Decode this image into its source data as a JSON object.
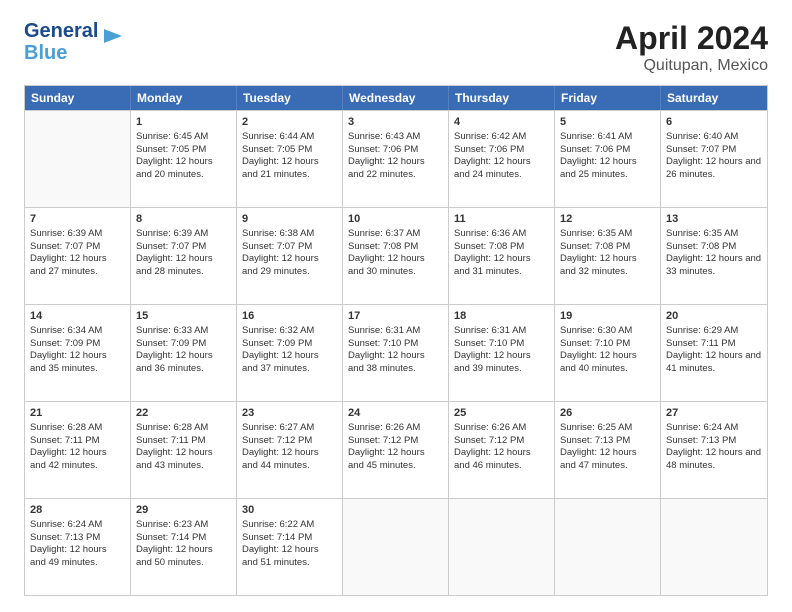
{
  "logo": {
    "line1": "General",
    "line2": "Blue"
  },
  "title": "April 2024",
  "subtitle": "Quitupan, Mexico",
  "weekdays": [
    "Sunday",
    "Monday",
    "Tuesday",
    "Wednesday",
    "Thursday",
    "Friday",
    "Saturday"
  ],
  "weeks": [
    [
      {
        "day": "",
        "info": ""
      },
      {
        "day": "1",
        "sunrise": "6:45 AM",
        "sunset": "7:05 PM",
        "daylight": "12 hours and 20 minutes."
      },
      {
        "day": "2",
        "sunrise": "6:44 AM",
        "sunset": "7:05 PM",
        "daylight": "12 hours and 21 minutes."
      },
      {
        "day": "3",
        "sunrise": "6:43 AM",
        "sunset": "7:06 PM",
        "daylight": "12 hours and 22 minutes."
      },
      {
        "day": "4",
        "sunrise": "6:42 AM",
        "sunset": "7:06 PM",
        "daylight": "12 hours and 24 minutes."
      },
      {
        "day": "5",
        "sunrise": "6:41 AM",
        "sunset": "7:06 PM",
        "daylight": "12 hours and 25 minutes."
      },
      {
        "day": "6",
        "sunrise": "6:40 AM",
        "sunset": "7:07 PM",
        "daylight": "12 hours and 26 minutes."
      }
    ],
    [
      {
        "day": "7",
        "sunrise": "6:39 AM",
        "sunset": "7:07 PM",
        "daylight": "12 hours and 27 minutes."
      },
      {
        "day": "8",
        "sunrise": "6:39 AM",
        "sunset": "7:07 PM",
        "daylight": "12 hours and 28 minutes."
      },
      {
        "day": "9",
        "sunrise": "6:38 AM",
        "sunset": "7:07 PM",
        "daylight": "12 hours and 29 minutes."
      },
      {
        "day": "10",
        "sunrise": "6:37 AM",
        "sunset": "7:08 PM",
        "daylight": "12 hours and 30 minutes."
      },
      {
        "day": "11",
        "sunrise": "6:36 AM",
        "sunset": "7:08 PM",
        "daylight": "12 hours and 31 minutes."
      },
      {
        "day": "12",
        "sunrise": "6:35 AM",
        "sunset": "7:08 PM",
        "daylight": "12 hours and 32 minutes."
      },
      {
        "day": "13",
        "sunrise": "6:35 AM",
        "sunset": "7:08 PM",
        "daylight": "12 hours and 33 minutes."
      }
    ],
    [
      {
        "day": "14",
        "sunrise": "6:34 AM",
        "sunset": "7:09 PM",
        "daylight": "12 hours and 35 minutes."
      },
      {
        "day": "15",
        "sunrise": "6:33 AM",
        "sunset": "7:09 PM",
        "daylight": "12 hours and 36 minutes."
      },
      {
        "day": "16",
        "sunrise": "6:32 AM",
        "sunset": "7:09 PM",
        "daylight": "12 hours and 37 minutes."
      },
      {
        "day": "17",
        "sunrise": "6:31 AM",
        "sunset": "7:10 PM",
        "daylight": "12 hours and 38 minutes."
      },
      {
        "day": "18",
        "sunrise": "6:31 AM",
        "sunset": "7:10 PM",
        "daylight": "12 hours and 39 minutes."
      },
      {
        "day": "19",
        "sunrise": "6:30 AM",
        "sunset": "7:10 PM",
        "daylight": "12 hours and 40 minutes."
      },
      {
        "day": "20",
        "sunrise": "6:29 AM",
        "sunset": "7:11 PM",
        "daylight": "12 hours and 41 minutes."
      }
    ],
    [
      {
        "day": "21",
        "sunrise": "6:28 AM",
        "sunset": "7:11 PM",
        "daylight": "12 hours and 42 minutes."
      },
      {
        "day": "22",
        "sunrise": "6:28 AM",
        "sunset": "7:11 PM",
        "daylight": "12 hours and 43 minutes."
      },
      {
        "day": "23",
        "sunrise": "6:27 AM",
        "sunset": "7:12 PM",
        "daylight": "12 hours and 44 minutes."
      },
      {
        "day": "24",
        "sunrise": "6:26 AM",
        "sunset": "7:12 PM",
        "daylight": "12 hours and 45 minutes."
      },
      {
        "day": "25",
        "sunrise": "6:26 AM",
        "sunset": "7:12 PM",
        "daylight": "12 hours and 46 minutes."
      },
      {
        "day": "26",
        "sunrise": "6:25 AM",
        "sunset": "7:13 PM",
        "daylight": "12 hours and 47 minutes."
      },
      {
        "day": "27",
        "sunrise": "6:24 AM",
        "sunset": "7:13 PM",
        "daylight": "12 hours and 48 minutes."
      }
    ],
    [
      {
        "day": "28",
        "sunrise": "6:24 AM",
        "sunset": "7:13 PM",
        "daylight": "12 hours and 49 minutes."
      },
      {
        "day": "29",
        "sunrise": "6:23 AM",
        "sunset": "7:14 PM",
        "daylight": "12 hours and 50 minutes."
      },
      {
        "day": "30",
        "sunrise": "6:22 AM",
        "sunset": "7:14 PM",
        "daylight": "12 hours and 51 minutes."
      },
      {
        "day": "",
        "info": ""
      },
      {
        "day": "",
        "info": ""
      },
      {
        "day": "",
        "info": ""
      },
      {
        "day": "",
        "info": ""
      }
    ]
  ]
}
